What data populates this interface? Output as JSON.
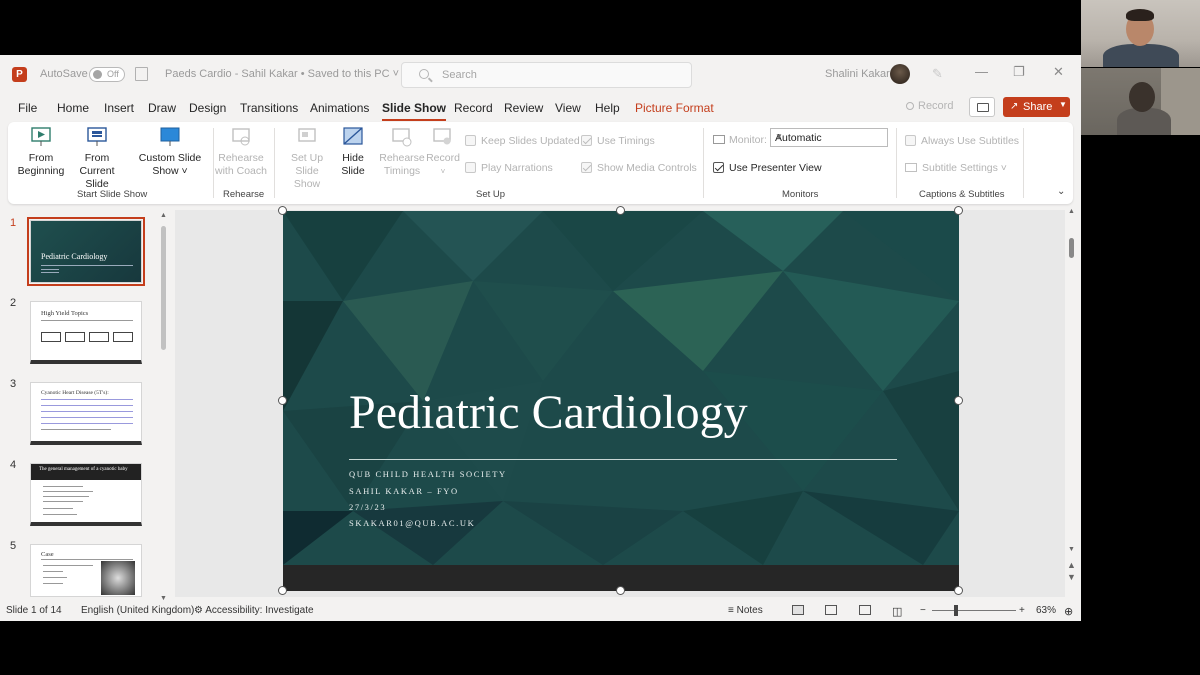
{
  "window": {
    "autosave_label": "AutoSave",
    "autosave_state": "Off",
    "doc_title": "Paeds Cardio - Sahil Kakar  •  Saved to this PC ˅",
    "search_placeholder": "Search",
    "user_name": "Shalini Kakar",
    "minimize": "—",
    "restore": "❐",
    "close": "✕"
  },
  "tabs": [
    "File",
    "Home",
    "Insert",
    "Draw",
    "Design",
    "Transitions",
    "Animations",
    "Slide Show",
    "Record",
    "Review",
    "View",
    "Help",
    "Picture Format"
  ],
  "active_tab": "Slide Show",
  "tab_actions": {
    "record": "Record",
    "share": "Share"
  },
  "ribbon": {
    "start_slide_show": {
      "label": "Start Slide Show",
      "from_beginning": "From Beginning",
      "from_current": "From Current Slide",
      "custom_show": "Custom Slide Show ˅"
    },
    "rehearse": {
      "label": "Rehearse",
      "rehearse_with_coach": "Rehearse with Coach"
    },
    "set_up": {
      "label": "Set Up",
      "set_up_slide_show": "Set Up Slide Show",
      "hide_slide": "Hide Slide",
      "rehearse_timings": "Rehearse Timings",
      "record": "Record",
      "keep_slides_updated": "Keep Slides Updated",
      "play_narrations": "Play Narrations",
      "use_timings": "Use Timings",
      "show_media_controls": "Show Media Controls"
    },
    "monitors": {
      "label": "Monitors",
      "monitor_label": "Monitor:",
      "monitor_value": "Automatic",
      "use_presenter_view": "Use Presenter View"
    },
    "captions": {
      "label": "Captions & Subtitles",
      "always_use_subtitles": "Always Use Subtitles",
      "subtitle_settings": "Subtitle Settings ˅"
    }
  },
  "thumbnails": [
    {
      "num": "1",
      "title": "Pediatric Cardiology"
    },
    {
      "num": "2",
      "title": "High Yield Topics"
    },
    {
      "num": "3",
      "title": "Cyanotic Heart Disease (5T's):"
    },
    {
      "num": "4",
      "title": "The general management of a cyanotic baby"
    },
    {
      "num": "5",
      "title": "Case"
    }
  ],
  "slide": {
    "title": "Pediatric Cardiology",
    "lines": [
      "QUB CHILD HEALTH SOCIETY",
      "SAHIL KAKAR – FYO",
      "27/3/23",
      "SKAKAR01@QUB.AC.UK"
    ]
  },
  "status": {
    "slide_of": "Slide 1 of 14",
    "language": "English (United Kingdom)",
    "accessibility": "Accessibility: Investigate",
    "notes": "Notes",
    "zoom": "63%"
  },
  "colors": {
    "accent": "#c43e1c",
    "slide_bg": "#1d4a4a"
  }
}
